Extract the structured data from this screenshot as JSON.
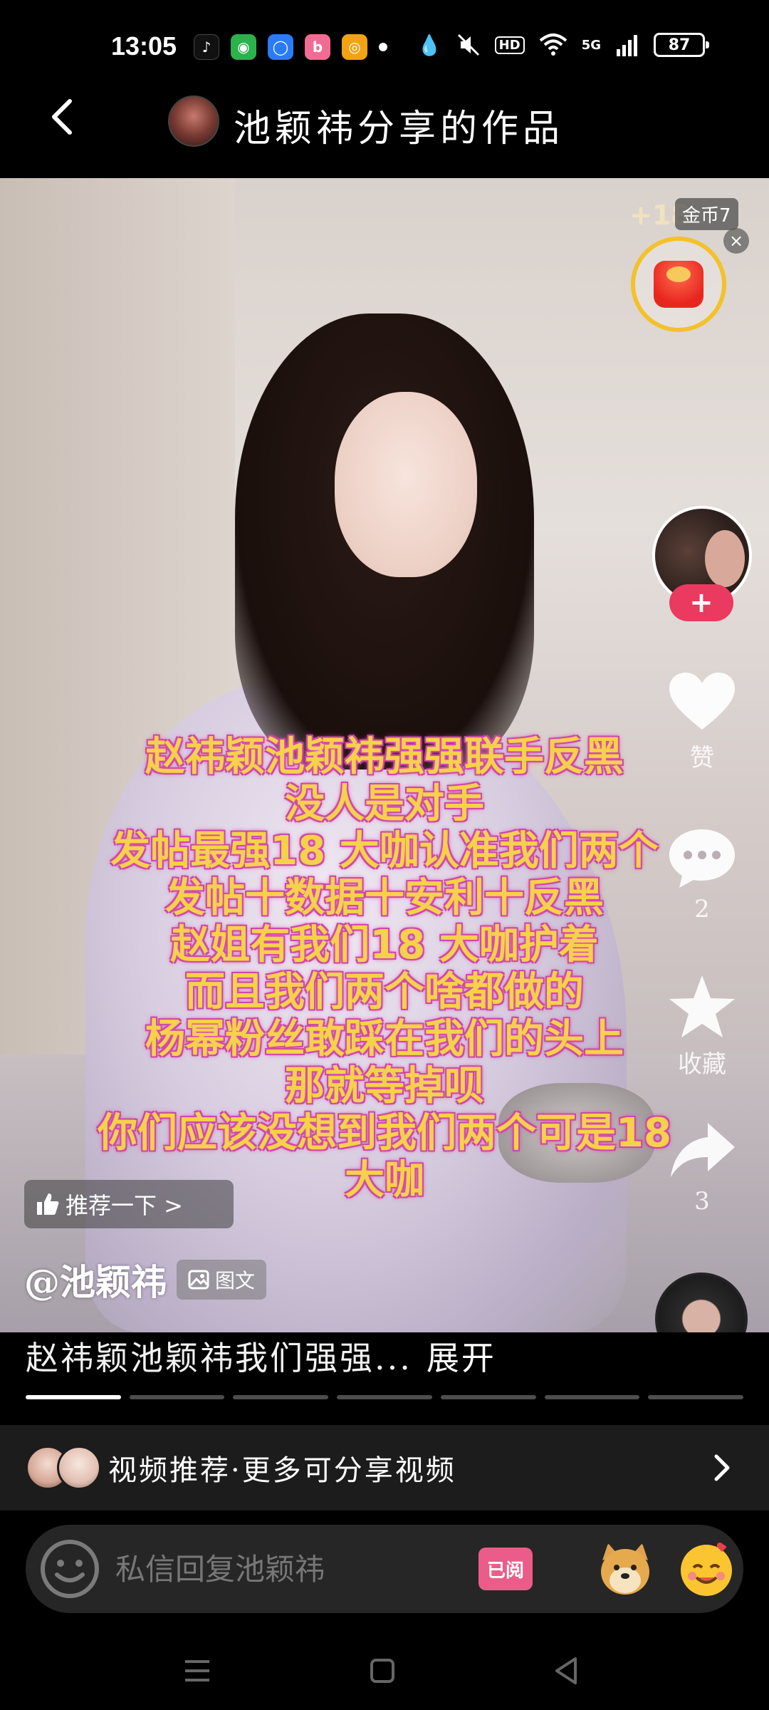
{
  "status_bar": {
    "time": "13:05",
    "battery": "87",
    "network": "5G",
    "hd_label": "HD",
    "apps": [
      {
        "name": "douyin-icon",
        "bg": "#111111",
        "glyph": "♪"
      },
      {
        "name": "wechat-icon",
        "bg": "#2bb24c",
        "glyph": "◉"
      },
      {
        "name": "browser-icon",
        "bg": "#2a7cf6",
        "glyph": "◯"
      },
      {
        "name": "bilibili-icon",
        "bg": "#f36b93",
        "glyph": "b"
      },
      {
        "name": "weibo-icon",
        "bg": "#f2a313",
        "glyph": "◎"
      }
    ]
  },
  "header": {
    "title": "池颖祎分享的作品"
  },
  "reward": {
    "plus": "+18",
    "tag": "金币7",
    "close": "×"
  },
  "overlay_text": [
    "赵祎颖池颖祎强强联手反黑",
    "没人是对手",
    "发帖最强18 大咖认准我们两个",
    "发帖十数据十安利十反黑",
    "赵姐有我们18 大咖护着",
    "而且我们两个啥都做的",
    "杨幂粉丝敢踩在我们的头上",
    "那就等掉呗",
    "你们应该没想到我们两个可是18",
    "大咖"
  ],
  "rail": {
    "follow": "+",
    "like_label": "赞",
    "comment_count": "2",
    "favorite_label": "收藏",
    "share_count": "3"
  },
  "recommend_chip": "推荐一下 >",
  "author": {
    "name": "@池颖祎",
    "post_type": "图文"
  },
  "caption": {
    "text": "赵祎颖池颖祎我们强强...",
    "expand": "展开"
  },
  "progress": {
    "total": 7,
    "active_index": 0
  },
  "rec_banner": {
    "text": "视频推荐·更多可分享视频"
  },
  "input": {
    "placeholder": "私信回复池颖祎",
    "read_badge": "已阅"
  },
  "colors": {
    "overlay_fill": "#f6d14a",
    "overlay_stroke": "#c4459f",
    "follow": "#ea3a5f",
    "reward_ring": "#f3c12a"
  }
}
